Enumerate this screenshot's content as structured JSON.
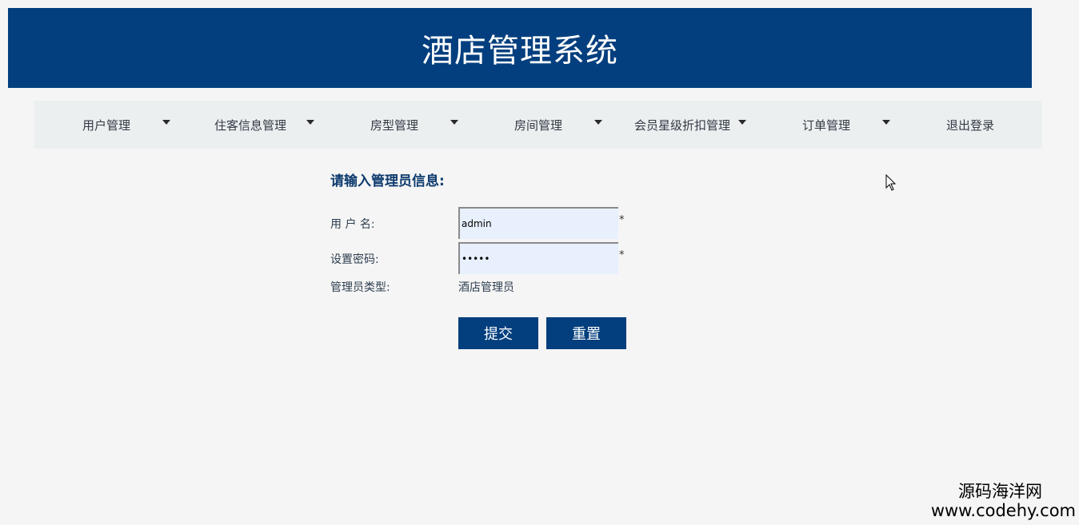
{
  "header": {
    "title": "酒店管理系统"
  },
  "nav": {
    "items": [
      {
        "label": "用户管理",
        "has_dropdown": true
      },
      {
        "label": "住客信息管理",
        "has_dropdown": true
      },
      {
        "label": "房型管理",
        "has_dropdown": true
      },
      {
        "label": "房间管理",
        "has_dropdown": true
      },
      {
        "label": "会员星级折扣管理",
        "has_dropdown": true
      },
      {
        "label": "订单管理",
        "has_dropdown": true
      },
      {
        "label": "退出登录",
        "has_dropdown": false
      }
    ]
  },
  "form": {
    "title": "请输入管理员信息:",
    "username_label": "用 户 名:",
    "username_value": "admin",
    "password_label": "设置密码:",
    "password_value": "•••••",
    "required_mark": "*",
    "admin_type_label": "管理员类型:",
    "admin_type_value": "酒店管理员",
    "submit_label": "提交",
    "reset_label": "重置"
  },
  "watermark": {
    "line1": "源码海洋网",
    "line2": "www.codehy.com"
  },
  "colors": {
    "brand": "#033f7e",
    "nav_bg": "#ebeff0",
    "page_bg": "#f5f5f5",
    "input_bg": "#e8f0fe"
  }
}
